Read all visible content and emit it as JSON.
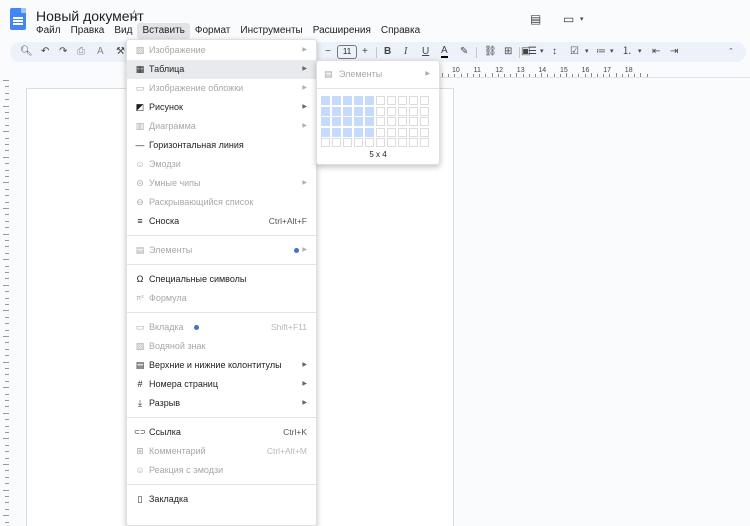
{
  "header": {
    "title": "Новый документ",
    "star_icon": "star-outline-icon"
  },
  "menubar": [
    {
      "label": "Файл",
      "active": false
    },
    {
      "label": "Правка",
      "active": false
    },
    {
      "label": "Вид",
      "active": false
    },
    {
      "label": "Вставить",
      "active": true
    },
    {
      "label": "Формат",
      "active": false
    },
    {
      "label": "Инструменты",
      "active": false
    },
    {
      "label": "Расширения",
      "active": false
    },
    {
      "label": "Справка",
      "active": false
    }
  ],
  "toolbar": {
    "font_size": "11",
    "minus": "−",
    "plus": "+",
    "bold": "B",
    "italic": "I",
    "underline": "U",
    "text_color": "A"
  },
  "ruler": {
    "numbers": [
      "10",
      "11",
      "12",
      "13",
      "14",
      "15",
      "16",
      "17",
      "18"
    ]
  },
  "insert_menu": {
    "items": [
      {
        "label": "Изображение",
        "icon": "image-icon",
        "disabled": true,
        "arrow": true
      },
      {
        "label": "Таблица",
        "icon": "table-icon",
        "disabled": false,
        "arrow": true,
        "highlighted": true
      },
      {
        "label": "Изображение обложки",
        "icon": "cover-image-icon",
        "disabled": true,
        "arrow": true
      },
      {
        "label": "Рисунок",
        "icon": "drawing-icon",
        "disabled": false,
        "arrow": true
      },
      {
        "label": "Диаграмма",
        "icon": "chart-icon",
        "disabled": true,
        "arrow": true
      },
      {
        "label": "Горизонтальная линия",
        "icon": "horizontal-line-icon",
        "disabled": false
      },
      {
        "label": "Эмодзи",
        "icon": "emoji-icon",
        "disabled": true
      },
      {
        "label": "Умные чипы",
        "icon": "smart-chips-icon",
        "disabled": true,
        "arrow": true
      },
      {
        "label": "Раскрывающийся список",
        "icon": "dropdown-icon",
        "disabled": true
      },
      {
        "label": "Сноска",
        "icon": "footnote-icon",
        "disabled": false,
        "shortcut": "Ctrl+Alt+F"
      },
      {
        "label": "Элементы",
        "icon": "building-blocks-icon",
        "disabled": true,
        "arrow": true,
        "dot": true,
        "sep_before": true
      },
      {
        "label": "Специальные символы",
        "icon": "omega-icon",
        "disabled": false,
        "sep_before": true
      },
      {
        "label": "Формула",
        "icon": "equation-icon",
        "disabled": true
      },
      {
        "label": "Вкладка",
        "icon": "tab-icon",
        "disabled": true,
        "shortcut": "Shift+F11",
        "dot": true,
        "sep_before": true
      },
      {
        "label": "Водяной знак",
        "icon": "watermark-icon",
        "disabled": true
      },
      {
        "label": "Верхние и нижние колонтитулы",
        "icon": "header-footer-icon",
        "disabled": false,
        "arrow": true
      },
      {
        "label": "Номера страниц",
        "icon": "hash-icon",
        "disabled": false,
        "arrow": true
      },
      {
        "label": "Разрыв",
        "icon": "break-icon",
        "disabled": false,
        "arrow": true
      },
      {
        "label": "Ссылка",
        "icon": "link-icon",
        "disabled": false,
        "shortcut": "Ctrl+K",
        "sep_before": true
      },
      {
        "label": "Комментарий",
        "icon": "comment-icon",
        "disabled": true,
        "shortcut": "Ctrl+Alt+M"
      },
      {
        "label": "Реакция с эмодзи",
        "icon": "emoji-reaction-icon",
        "disabled": true
      },
      {
        "label": "Закладка",
        "icon": "bookmark-icon",
        "disabled": false,
        "sep_before": true
      }
    ]
  },
  "table_submenu": {
    "item_label": "Элементы",
    "grid_label": "5 x 4",
    "selected_cols": 5,
    "selected_rows": 4,
    "grid_cols": 10,
    "grid_rows": 5,
    "selected_color": "#c6dafc"
  }
}
